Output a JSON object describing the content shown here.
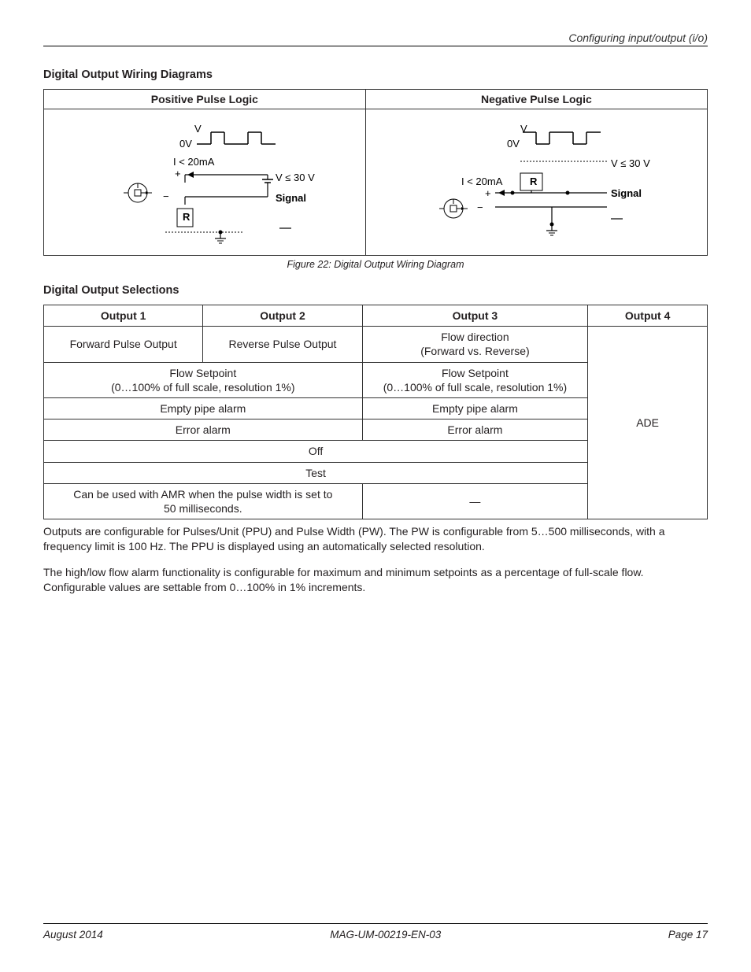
{
  "header": {
    "breadcrumb": "Configuring input/output (i/o)"
  },
  "section1": {
    "heading": "Digital Output Wiring Diagrams",
    "col1_header": "Positive Pulse Logic",
    "col2_header": "Negative Pulse Logic",
    "caption": "Figure 22:  Digital Output Wiring Diagram",
    "labels": {
      "v": "V",
      "zero_v": "0V",
      "current": "I < 20mA",
      "voltage": "V ≤ 30 V",
      "signal": "Signal",
      "r": "R",
      "plus": "+",
      "minus": "−"
    }
  },
  "section2": {
    "heading": "Digital Output Selections",
    "headers": [
      "Output 1",
      "Output 2",
      "Output 3",
      "Output 4"
    ],
    "rows": {
      "r1_out1": "Forward Pulse Output",
      "r1_out2": "Reverse Pulse Output",
      "r1_out3": "Flow direction\n(Forward vs. Reverse)",
      "r2_col12": "Flow Setpoint\n(0…100% of full scale, resolution 1%)",
      "r2_out3": "Flow Setpoint\n(0…100% of full scale, resolution 1%)",
      "r3_col12": "Empty pipe alarm",
      "r3_out3": "Empty pipe alarm",
      "r4_col12": "Error alarm",
      "r4_out3": "Error alarm",
      "r5_col123": "Off",
      "r6_col123": "Test",
      "r7_col12": "Can be used with AMR when the pulse width is set to\n50 milliseconds.",
      "r7_out3": "—",
      "out4": "ADE"
    }
  },
  "paragraphs": {
    "p1": "Outputs are configurable for Pulses/Unit (PPU) and Pulse Width (PW). The PW is configurable from 5…500 milliseconds, with a frequency limit is 100 Hz. The PPU is displayed using an automatically selected resolution.",
    "p2": "The high/low flow alarm functionality is configurable for maximum and minimum setpoints as a percentage of full-scale flow. Configurable values are settable from 0…100% in 1% increments."
  },
  "footer": {
    "left": "August 2014",
    "center": "MAG-UM-00219-EN-03",
    "right": "Page 17"
  }
}
